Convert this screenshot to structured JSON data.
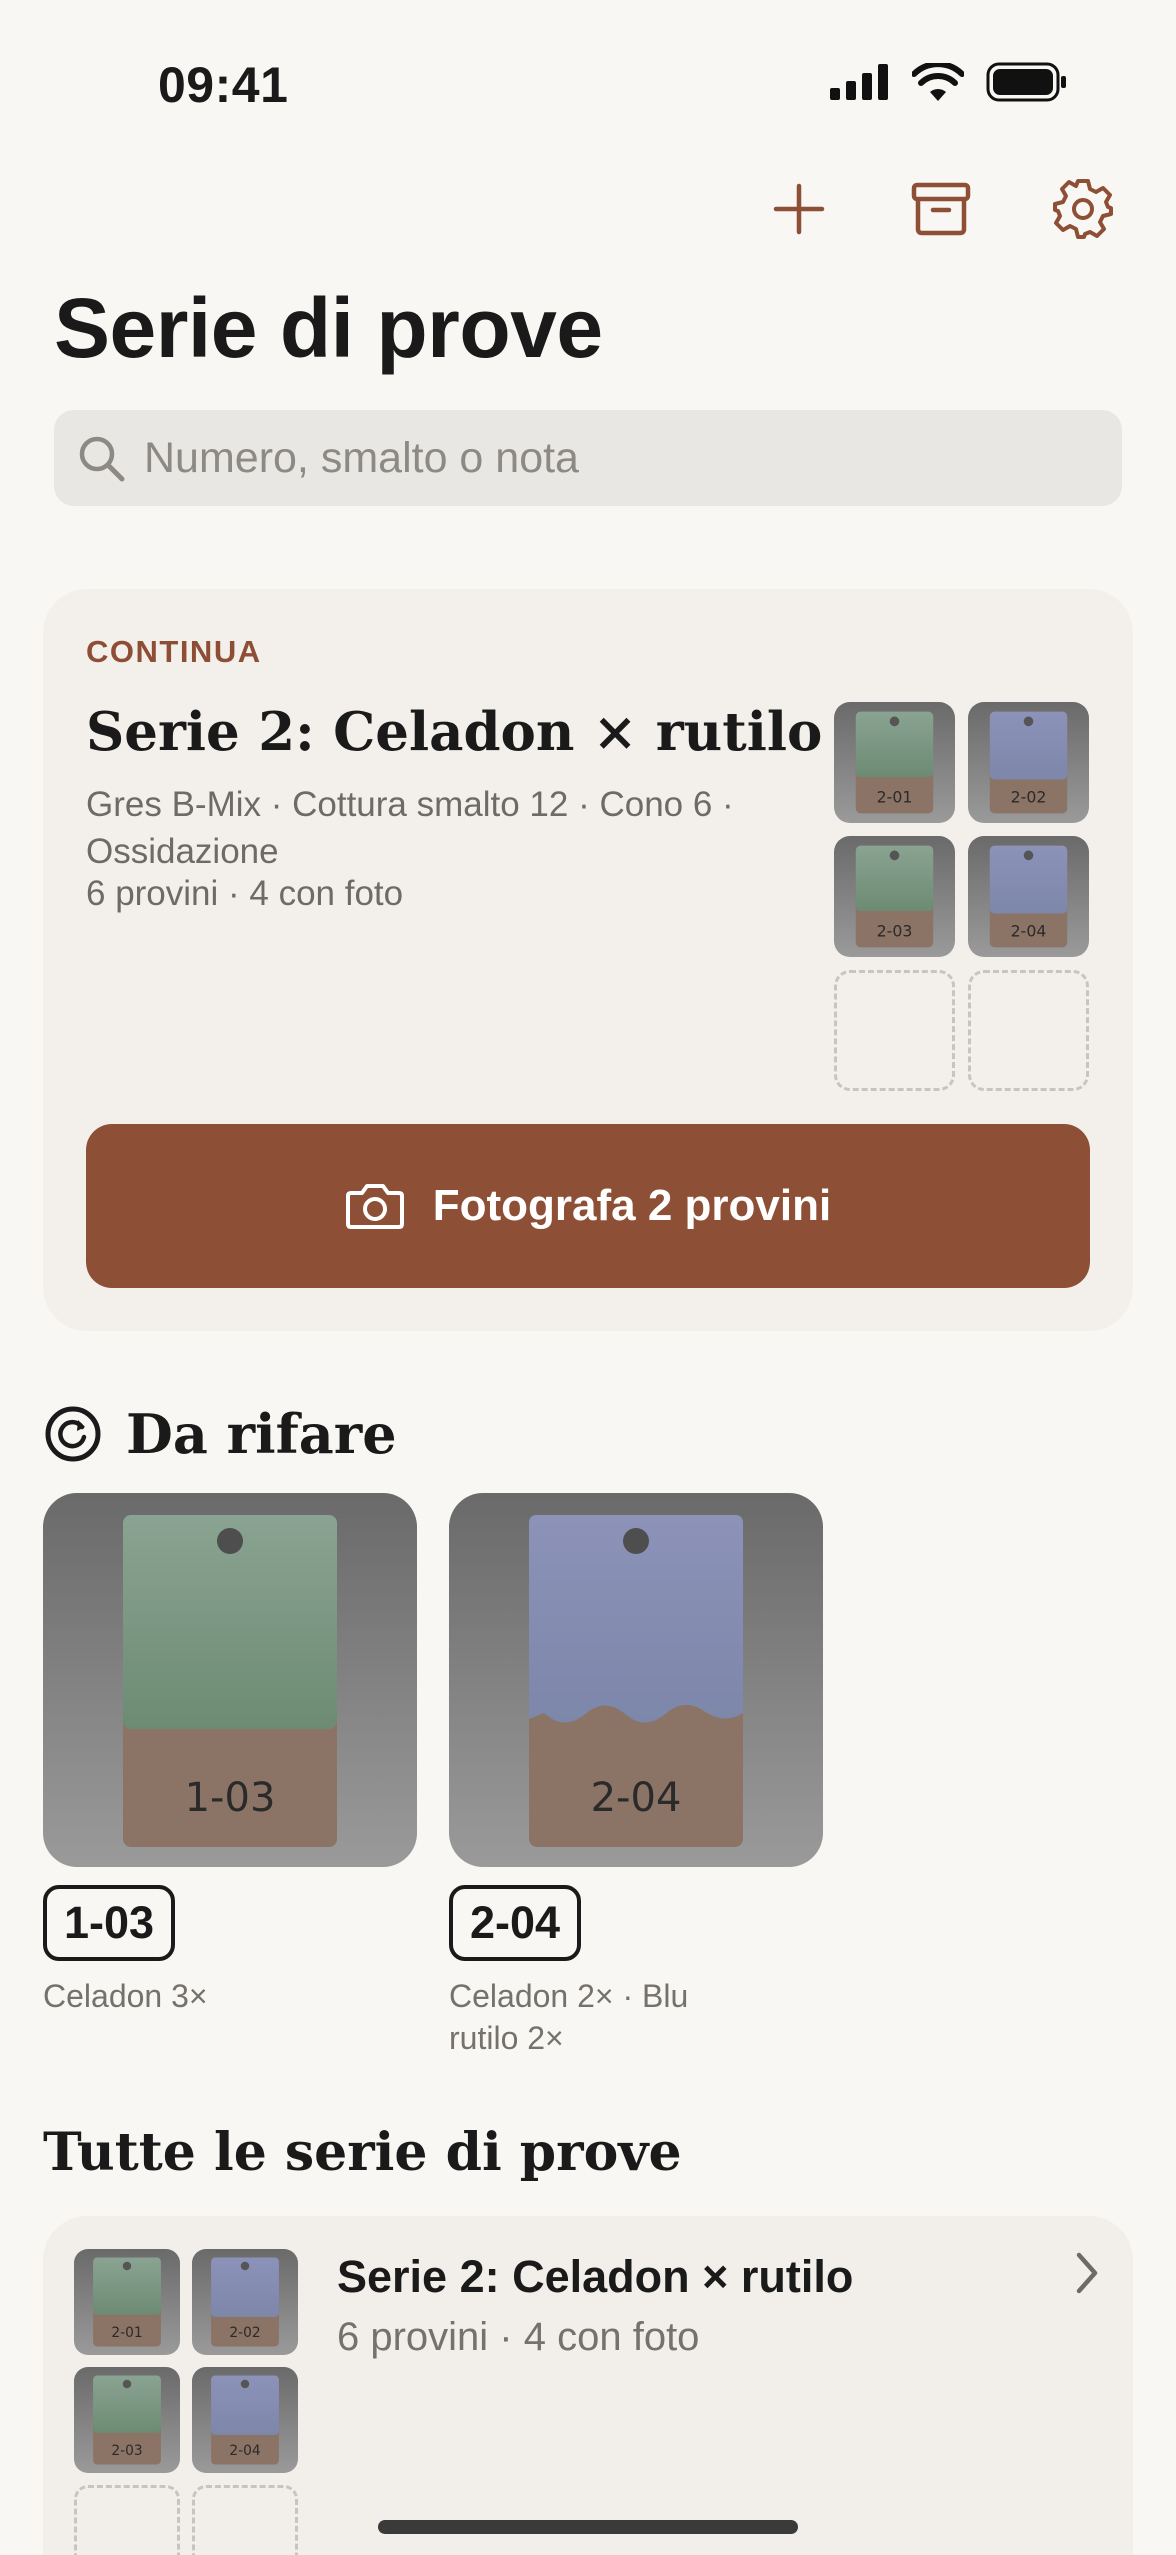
{
  "status": {
    "time": "09:41",
    "icons": [
      "signal-icon",
      "wifi-icon",
      "battery-icon"
    ]
  },
  "toolbar": {
    "buttons": [
      "plus-icon",
      "archive-icon",
      "gear-icon"
    ]
  },
  "page": {
    "title": "Serie di prove"
  },
  "search": {
    "placeholder": "Numero, smalto o nota"
  },
  "continue_card": {
    "label": "CONTINUA",
    "title": "Serie 2: Celadon × rutilo",
    "meta": "Gres B-Mix · Cottura smalto 12 · Cono 6 · Ossidazione",
    "count": "6 provini · 4 con foto",
    "thumbs": [
      "2-01",
      "2-02",
      "2-03",
      "2-04"
    ],
    "empty_slots": 2,
    "button_label": "Fotografa 2 provini"
  },
  "redo": {
    "title": "Da rifare",
    "items": [
      {
        "code": "1-03",
        "desc": "Celadon 3×"
      },
      {
        "code": "2-04",
        "desc": "Celadon 2× · Blu rutilo 2×"
      }
    ]
  },
  "all_series": {
    "title": "Tutte le serie di prove",
    "items": [
      {
        "title": "Serie 2: Celadon × rutilo",
        "meta": "6 provini · 4 con foto",
        "thumbs": [
          "2-01",
          "2-02",
          "2-03",
          "2-04"
        ]
      }
    ]
  },
  "colors": {
    "accent": "#8d4f36",
    "label_accent": "#8e4e35",
    "background": "#f9f7f3",
    "card": "#f3f0eb",
    "celadon_green": "#7f9a86",
    "rutile_blue": "#8a90b4",
    "clay": "#8b7466"
  }
}
